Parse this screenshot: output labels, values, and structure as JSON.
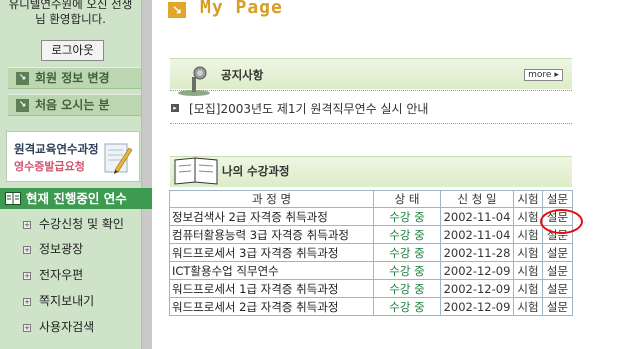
{
  "sidebar": {
    "welcome_line1": "유니텔연수원에 오신 선생",
    "welcome_line2": "님 환영합니다.",
    "logout_label": "로그아웃",
    "menu": [
      {
        "label": "회원 정보 변경"
      },
      {
        "label": "처음 오시는 분"
      }
    ],
    "banner_line1": "원격교육연수과정",
    "banner_line2": "영수증발급요청",
    "current_label": "현재 진행중인 연수",
    "subitems": [
      {
        "label": "수강신청 및 확인"
      },
      {
        "label": "정보광장"
      },
      {
        "label": "전자우편"
      },
      {
        "label": "쪽지보내기"
      },
      {
        "label": "사용자검색"
      }
    ]
  },
  "main": {
    "page_title": "My Page",
    "notice": {
      "title": "공지사항",
      "more_label": "more",
      "item": "[모집]2003년도 제1기 원격직무연수 실시 안내"
    },
    "courses": {
      "title": "나의 수강과정",
      "headers": [
        "과 정 명",
        "상 태",
        "신 청 일",
        "시험",
        "설문"
      ],
      "rows": [
        {
          "name": "정보검색사 2급 자격증 취득과정",
          "status": "수강 중",
          "date": "2002-11-04",
          "exam": "시험",
          "survey": "설문"
        },
        {
          "name": "컴퓨터활용능력 3급 자격증 취득과정",
          "status": "수강 중",
          "date": "2002-11-04",
          "exam": "시험",
          "survey": "설문"
        },
        {
          "name": "워드프로세서 3급 자격증 취득과정",
          "status": "수강 중",
          "date": "2002-11-28",
          "exam": "시험",
          "survey": "설문"
        },
        {
          "name": "ICT활용수업 직무연수",
          "status": "수강 중",
          "date": "2002-12-09",
          "exam": "시험",
          "survey": "설문"
        },
        {
          "name": "워드프로세서 1급 자격증 취득과정",
          "status": "수강 중",
          "date": "2002-12-09",
          "exam": "시험",
          "survey": "설문"
        },
        {
          "name": "워드프로세서 2급 자격증 취득과정",
          "status": "수강 중",
          "date": "2002-12-09",
          "exam": "시험",
          "survey": "설문"
        }
      ]
    }
  },
  "colors": {
    "sidebar_bg": "#cfe3c8",
    "current_bg": "#3c9a51",
    "title_orange": "#d79d24",
    "status_green": "#19813c",
    "highlight_red": "#e21010"
  }
}
